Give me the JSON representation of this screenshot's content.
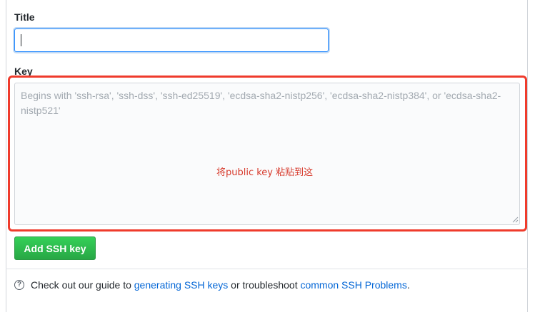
{
  "form": {
    "title_label": "Title",
    "title_value": "",
    "key_label": "Key",
    "key_placeholder": "Begins with 'ssh-rsa', 'ssh-dss', 'ssh-ed25519', 'ecdsa-sha2-nistp256', 'ecdsa-sha2-nistp384', or 'ecdsa-sha2-nistp521'",
    "annotation": "将public key 粘贴到这",
    "submit_label": "Add SSH key"
  },
  "footer": {
    "icon": "question-circle-icon",
    "text_before": "Check out our guide to ",
    "link1": "generating SSH keys",
    "text_middle": " or troubleshoot ",
    "link2": "common SSH Problems",
    "text_after": "."
  },
  "colors": {
    "highlight": "#ef3b2c",
    "annotation": "#d73a2c",
    "button": "#28a745",
    "link": "#0366d6",
    "focus": "#2188ff"
  }
}
